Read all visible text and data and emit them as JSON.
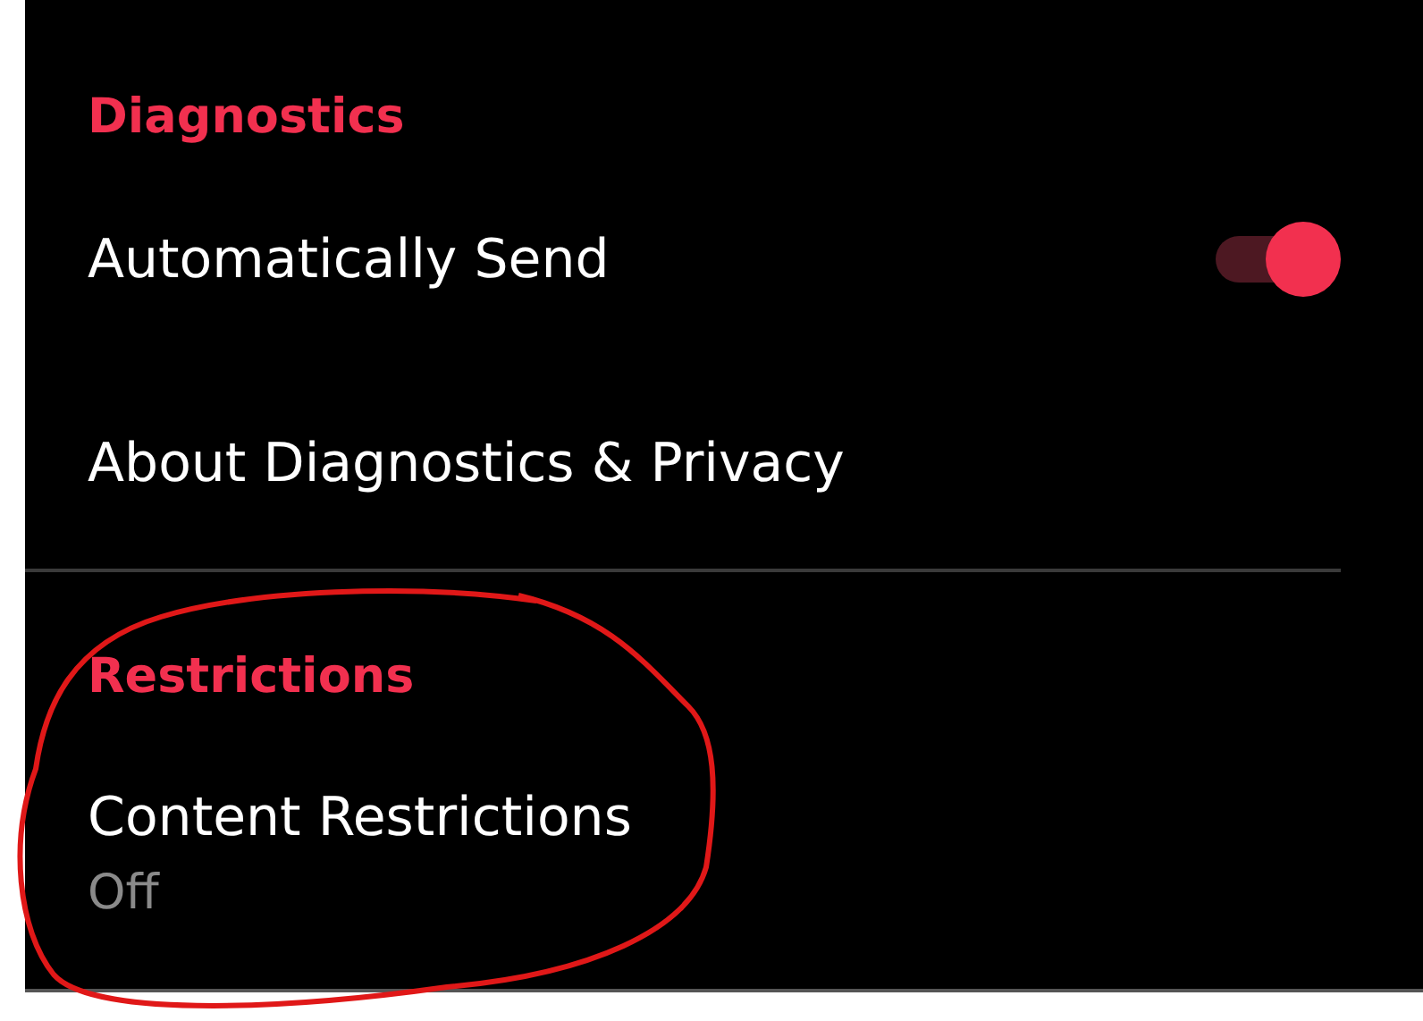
{
  "sections": [
    {
      "header": "Diagnostics",
      "items": [
        {
          "kind": "toggle",
          "label": "Automatically Send",
          "on": true
        },
        {
          "kind": "link",
          "label": "About Diagnostics & Privacy"
        }
      ]
    },
    {
      "header": "Restrictions",
      "items": [
        {
          "kind": "value",
          "label": "Content Restrictions",
          "value": "Off"
        }
      ]
    }
  ]
}
